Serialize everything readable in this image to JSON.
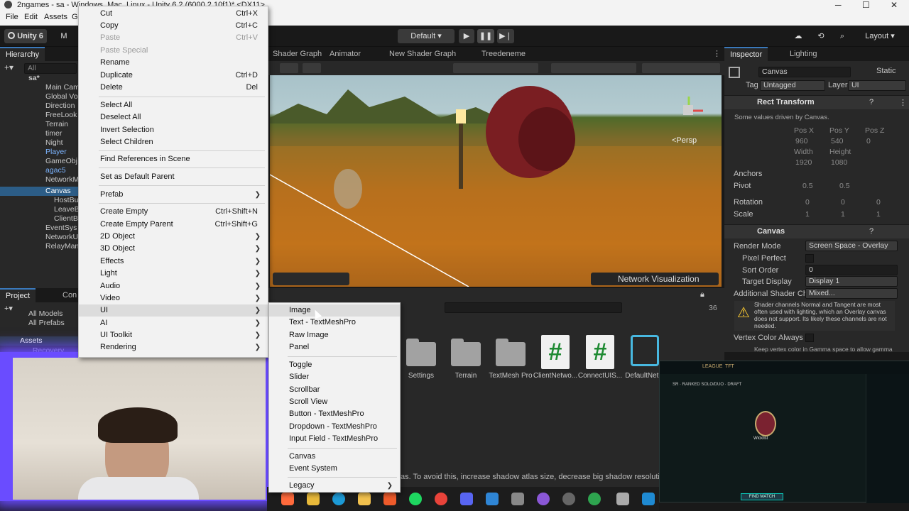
{
  "window": {
    "title": "2ngames - sa - Windows, Mac, Linux - Unity 6.2 (6000.2.10f1)* <DX11>",
    "controls": [
      "─",
      "☐",
      "✕"
    ]
  },
  "menubar": [
    "File",
    "Edit",
    "Assets",
    "G"
  ],
  "toolbar": {
    "unity_label": "Unity 6",
    "account_initial": "M",
    "layout_label": "Default",
    "layout_right_label": "Layout"
  },
  "hierarchy": {
    "tab_label": "Hierarchy",
    "search_placeholder": "All",
    "scene_name": "sa*",
    "items": [
      "Main Cam",
      "Global Vo",
      "Direction",
      "FreeLook",
      "Terrain",
      "timer",
      "Night",
      "Player",
      "GameObj",
      "agac5",
      "NetworkM",
      "Canvas",
      "HostBu",
      "LeaveB",
      "ClientB",
      "EventSys",
      "NetworkU",
      "RelayMan"
    ]
  },
  "center_tabs": [
    "Shader Graph",
    "Animator",
    "New Shader Graph",
    "Treedeneme"
  ],
  "scene": {
    "persp_label": "<Persp",
    "network_viz_label": "Network Visualization"
  },
  "context_menu": {
    "items": [
      {
        "label": "Cut",
        "shortcut": "Ctrl+X"
      },
      {
        "label": "Copy",
        "shortcut": "Ctrl+C"
      },
      {
        "label": "Paste",
        "shortcut": "Ctrl+V",
        "disabled": true
      },
      {
        "label": "Paste Special",
        "shortcut": "",
        "disabled": true
      },
      {
        "label": "Rename",
        "shortcut": ""
      },
      {
        "label": "Duplicate",
        "shortcut": "Ctrl+D"
      },
      {
        "label": "Delete",
        "shortcut": "Del"
      },
      {
        "label": "Select All",
        "shortcut": ""
      },
      {
        "label": "Deselect All",
        "shortcut": ""
      },
      {
        "label": "Invert Selection",
        "shortcut": ""
      },
      {
        "label": "Select Children",
        "shortcut": ""
      },
      {
        "label": "Find References in Scene",
        "shortcut": ""
      },
      {
        "label": "Set as Default Parent",
        "shortcut": ""
      },
      {
        "label": "Prefab",
        "shortcut": ""
      },
      {
        "label": "Create Empty",
        "shortcut": "Ctrl+Shift+N"
      },
      {
        "label": "Create Empty Parent",
        "shortcut": "Ctrl+Shift+G"
      },
      {
        "label": "2D Object",
        "shortcut": ""
      },
      {
        "label": "3D Object",
        "shortcut": ""
      },
      {
        "label": "Effects",
        "shortcut": ""
      },
      {
        "label": "Light",
        "shortcut": ""
      },
      {
        "label": "Audio",
        "shortcut": ""
      },
      {
        "label": "Video",
        "shortcut": ""
      },
      {
        "label": "UI",
        "shortcut": ""
      },
      {
        "label": "AI",
        "shortcut": ""
      },
      {
        "label": "UI Toolkit",
        "shortcut": ""
      },
      {
        "label": "Rendering",
        "shortcut": ""
      }
    ]
  },
  "ui_submenu": {
    "items": [
      "Image",
      "Text - TextMeshPro",
      "Raw Image",
      "Panel",
      "Toggle",
      "Slider",
      "Scrollbar",
      "Scroll View",
      "Button - TextMeshPro",
      "Dropdown - TextMeshPro",
      "Input Field - TextMeshPro",
      "Canvas",
      "Event System",
      "Legacy"
    ]
  },
  "project": {
    "tabs": [
      "Project",
      "Con"
    ],
    "favorites": [
      "All Models",
      "All Prefabs"
    ],
    "assets_root": "Assets",
    "assets_child": "_Recovery",
    "item_count": "36",
    "assets": [
      "Settings",
      "Terrain",
      "TextMesh Pro",
      "ClientNetwo...",
      "ConnectUIS...",
      "DefaultNet..."
    ]
  },
  "console_message": "as. To avoid this, increase shadow atlas size, decrease big shadow resolution",
  "inspector": {
    "tabs": [
      "Inspector",
      "Lighting"
    ],
    "object_name": "Canvas",
    "static_label": "Static",
    "tag_label": "Tag",
    "tag_value": "Untagged",
    "layer_label": "Layer",
    "layer_value": "UI",
    "rect_transform": {
      "title": "Rect Transform",
      "note": "Some values driven by Canvas.",
      "pos_labels": [
        "Pos X",
        "Pos Y",
        "Pos Z"
      ],
      "pos_values": [
        "960",
        "540",
        "0"
      ],
      "size_labels": [
        "Width",
        "Height"
      ],
      "size_values": [
        "1920",
        "1080"
      ],
      "anchors": "Anchors",
      "pivot": "Pivot",
      "pivot_x": "0.5",
      "pivot_y": "0.5",
      "rotation": "Rotation",
      "rot_values": [
        "0",
        "0",
        "0"
      ],
      "scale": "Scale",
      "scale_values": [
        "1",
        "1",
        "1"
      ]
    },
    "canvas": {
      "title": "Canvas",
      "render_mode_label": "Render Mode",
      "render_mode_value": "Screen Space - Overlay",
      "pixel_perfect_label": "Pixel Perfect",
      "sort_order_label": "Sort Order",
      "sort_order_value": "0",
      "target_display_label": "Target Display",
      "target_display_value": "Display 1",
      "additional_shader_label": "Additional Shader Ch",
      "additional_shader_value": "Mixed...",
      "warning": "Shader channels Normal and Tangent are most often used with lighting, which an Overlay canvas does not support. Its likely these channels are not needed.",
      "vertex_color_label": "Vertex Color Always I",
      "vertex_note": "Keep vertex color in Gamma space to allow gamma"
    }
  },
  "overlay_game": {
    "nav": [
      "LEAGUE",
      "TFT"
    ],
    "mode": "SR · RANKED SOLO/DUO · DRAFT",
    "player": "Wicklist",
    "find_match": "FIND MATCH"
  },
  "colors": {
    "accent_blue": "#3a79bb",
    "selection": "#2c5d87",
    "menu_bg": "#f2f2f2",
    "webcam_glow": "#6a4cff"
  }
}
